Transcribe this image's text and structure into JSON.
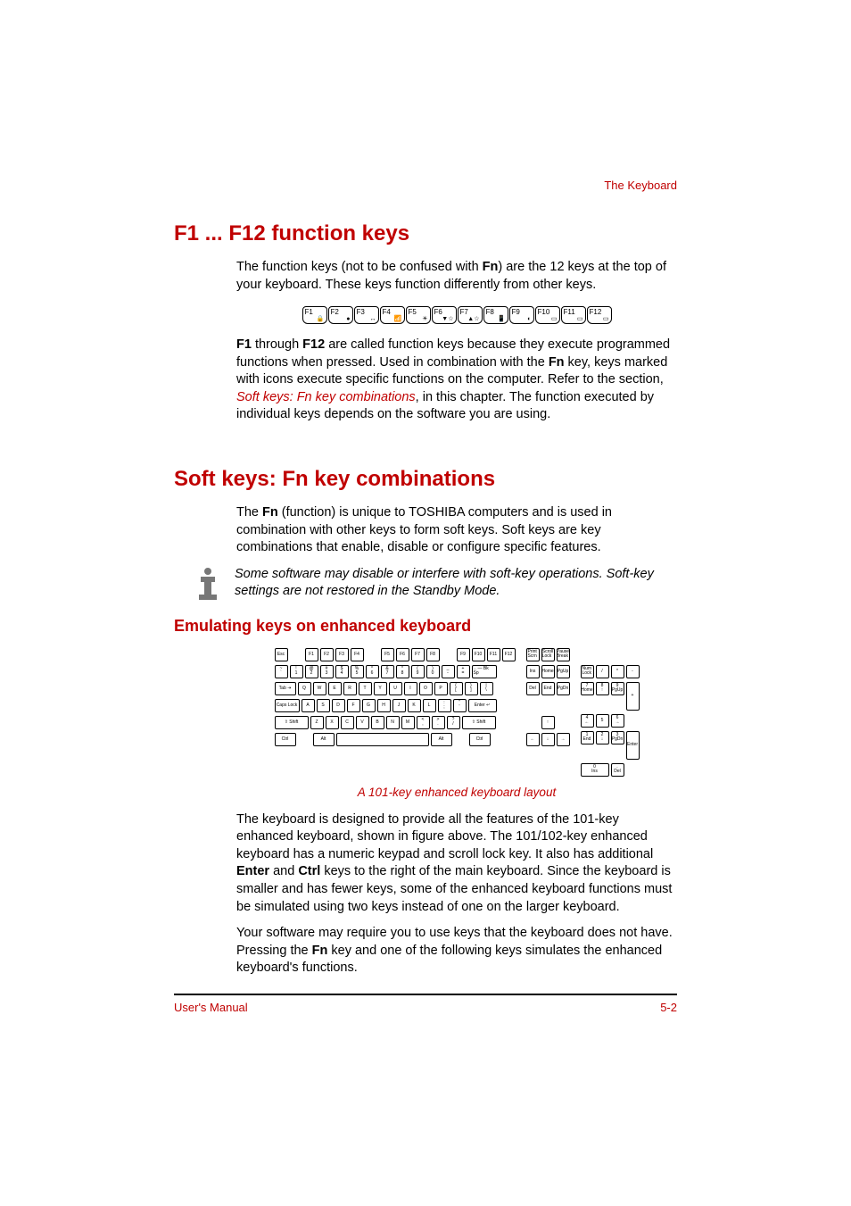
{
  "header": {
    "chapter_label": "The Keyboard"
  },
  "section1": {
    "title": "F1 ... F12 function keys",
    "para1_a": "The function keys (not to be confused with ",
    "para1_fn": "Fn",
    "para1_b": ") are the 12 keys at the top of your keyboard. These keys function differently from other keys.",
    "fn_keys": [
      "F1",
      "F2",
      "F3",
      "F4",
      "F5",
      "F6",
      "F7",
      "F8",
      "F9",
      "F10",
      "F11",
      "F12"
    ],
    "para2_a": "F1",
    "para2_b": " through ",
    "para2_c": "F12",
    "para2_d": " are called function keys because they execute programmed functions when pressed. Used in combination with the ",
    "para2_e": "Fn",
    "para2_f": " key, keys marked with icons execute specific functions on the computer. Refer to the section, ",
    "para2_link": "Soft keys: Fn key combinations",
    "para2_g": ", in this chapter. The function executed by individual keys depends on the software you are using."
  },
  "section2": {
    "title": "Soft keys: Fn key combinations",
    "para1_a": "The ",
    "para1_b": "Fn",
    "para1_c": " (function) is unique to TOSHIBA computers and is used in combination with other keys to form soft keys. Soft keys are key combinations that enable, disable or configure specific features.",
    "note": "Some software may disable or interfere with soft-key operations. Soft-key settings are not restored in the Standby Mode.",
    "subheading": "Emulating keys on enhanced keyboard",
    "caption": "A 101-key enhanced keyboard layout",
    "para2_a": "The keyboard is designed to provide all the features of the 101-key enhanced keyboard, shown in figure above. The 101/102-key enhanced keyboard has a numeric keypad and scroll lock key. It also has additional ",
    "para2_b": "Enter",
    "para2_c": " and ",
    "para2_d": "Ctrl",
    "para2_e": " keys to the right of the main keyboard. Since the keyboard is smaller and has fewer keys, some of the enhanced keyboard functions must be simulated using two keys instead of one on the larger keyboard.",
    "para3_a": "Your software may require you to use keys that the keyboard does not have. Pressing the ",
    "para3_b": "Fn",
    "para3_c": " key and one of the following keys simulates the enhanced keyboard's functions."
  },
  "keyboard_layout": {
    "row_fn": [
      "Esc",
      "",
      "F1",
      "F2",
      "F3",
      "F4",
      "",
      "F5",
      "F6",
      "F7",
      "F8",
      "",
      "F9",
      "F10",
      "F11",
      "F12"
    ],
    "row_fn_right": [
      "Print\nScrn",
      "Scroll\nLock",
      "Pause\nBreak"
    ],
    "row1": [
      [
        "~",
        "`"
      ],
      [
        "!",
        "1"
      ],
      [
        "@",
        "2"
      ],
      [
        "#",
        "3"
      ],
      [
        "$",
        "4"
      ],
      [
        "%",
        "5"
      ],
      [
        "^",
        "6"
      ],
      [
        "&",
        "7"
      ],
      [
        "*",
        "8"
      ],
      [
        "(",
        "9"
      ],
      [
        ")",
        "0"
      ],
      [
        "_",
        "-"
      ],
      [
        "+",
        "="
      ]
    ],
    "row1_wide": "←—  Bk Sp",
    "row1_nav": [
      "Ins",
      "Home",
      "PgUp"
    ],
    "row1_num": [
      "Num\nLock",
      "/",
      "*",
      "-"
    ],
    "row2_lead": "Tab ⇥",
    "row2": [
      "Q",
      "W",
      "E",
      "R",
      "T",
      "Y",
      "U",
      "I",
      "O",
      "P",
      [
        "{",
        "["
      ],
      [
        "}",
        "]"
      ],
      [
        "|",
        "\\"
      ]
    ],
    "row2_nav": [
      "Del",
      "End",
      "PgDn"
    ],
    "row2_num": [
      [
        "7",
        "Home"
      ],
      [
        "8",
        "↑"
      ],
      [
        "9",
        "PgUp"
      ]
    ],
    "row2_num_plus": "+",
    "row3_lead": "Caps Lock",
    "row3": [
      "A",
      "S",
      "D",
      "F",
      "G",
      "H",
      "J",
      "K",
      "L",
      [
        ":",
        ";"
      ],
      [
        "\"",
        "'"
      ]
    ],
    "row3_enter": "Enter ↵",
    "row3_num": [
      [
        "4",
        "←"
      ],
      [
        "5",
        ""
      ],
      [
        "6",
        "→"
      ]
    ],
    "row4_lead": "⇧ Shift",
    "row4": [
      "Z",
      "X",
      "C",
      "V",
      "B",
      "N",
      "M",
      [
        "<",
        ","
      ],
      [
        ">",
        "."
      ],
      [
        "?",
        "/"
      ]
    ],
    "row4_shift": "⇧ Shift",
    "row4_arrow_up": "↑",
    "row4_num": [
      [
        "1",
        "End"
      ],
      [
        "2",
        "↓"
      ],
      [
        "3",
        "PgDn"
      ]
    ],
    "row4_num_enter": "Enter",
    "row5": [
      "Ctrl",
      "",
      "Alt"
    ],
    "row5_space": "",
    "row5_right": [
      "Alt",
      "",
      "Ctrl"
    ],
    "row5_arrows": [
      "←",
      "↓",
      "→"
    ],
    "row5_num": [
      [
        "0",
        "Ins"
      ],
      [
        ".",
        "Del"
      ]
    ]
  },
  "footer": {
    "left": "User's Manual",
    "right": "5-2"
  }
}
